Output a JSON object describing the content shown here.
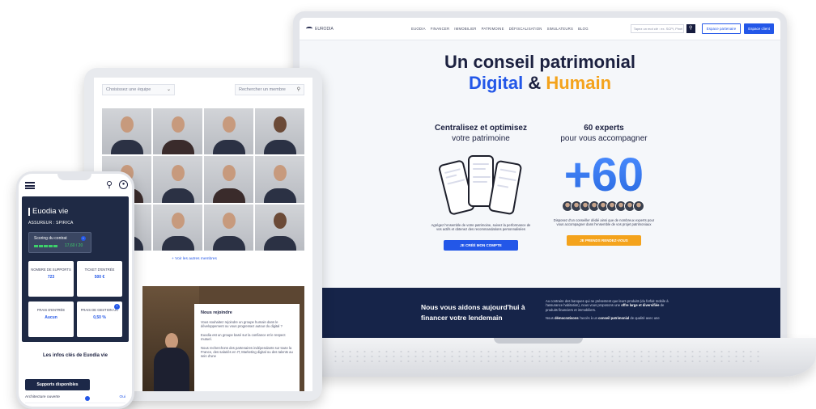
{
  "laptop": {
    "nav": {
      "logo": "EURODIA",
      "menu": [
        "EUODIA",
        "FINANCER",
        "IMMOBILIER",
        "PATRIMOINE",
        "DÉFISCALISATION",
        "SIMULATEURS",
        "BLOG"
      ],
      "search_placeholder": "Tapez un mot clé : ex. SCPI, Pinel",
      "search_icon": "search-icon",
      "btn_partner": "Espace partenaire",
      "btn_client": "Espace client"
    },
    "hero": {
      "line1": "Un conseil patrimonial",
      "word_digital": "Digital",
      "amp": "&",
      "word_humain": "Humain"
    },
    "left_col": {
      "title_l1": "Centralisez et optimisez",
      "title_l2": "votre patrimoine",
      "desc": "Agrégez l'ensemble de votre patrimoine, suivez la performance de vos actifs et obtenez des recommandations personnalisées",
      "cta": "JE CRÉÉ MON COMPTE"
    },
    "right_col": {
      "title_l1": "60 experts",
      "title_l2": "pour vous accompagner",
      "big_number": "+60",
      "desc": "Disposez d'un conseiller dédié ainsi que de nombreux experts pour vous accompagner dans l'ensemble de vos projet patrimoniaux",
      "cta": "JE PRENDS RENDEZ-VOUS"
    },
    "band": {
      "title": "Nous vous aidons aujourd'hui à financer votre lendemain",
      "p1_a": "Au contraire des banques qui ne présentent que leurs produits (du forfait mobile à l'assurance habitation), nous vous proposons une ",
      "p1_b": "offre large et diversifiée",
      "p1_c": " de produits financiers et immobiliers.",
      "p2_a": "Nous ",
      "p2_b": "démocratisons",
      "p2_c": " l'accès à un ",
      "p2_d": "conseil patrimonial",
      "p2_e": " de qualité avec une"
    },
    "colors": {
      "primary": "#2357e8",
      "accent": "#f4a31c",
      "navy": "#162449"
    }
  },
  "tablet": {
    "select_placeholder": "Choisissez une équipe",
    "search_placeholder": "Rechercher un membre",
    "more_link": "+ Voir les autres membres",
    "join": {
      "title": "Nous rejoindre",
      "p1": "Vous souhaitez rejoindre un groupe humain dans le développement ou vous progressez autour du digital ?",
      "p2": "Euodia est un groupe basé sur la confiance et le respect mutuel.",
      "p3": "Nous recherchons des partenaires indépendants sur toute la France, des salariés en IT, Marketing digital ou des talents au sein d'une"
    }
  },
  "phone": {
    "title": "Euodia vie",
    "insurer": "ASSUREUR : SPIRICA",
    "scoring_label": "Scoring du contrat",
    "score_value": "17,60 / 20",
    "cards": [
      {
        "label": "NOMBRE DE SUPPORTS",
        "value": "723"
      },
      {
        "label": "TICKET D'ENTRÉE",
        "value": "500 €"
      },
      {
        "label": "FRAIS D'ENTRÉE",
        "value": "Aucun"
      },
      {
        "label": "FRAIS DE GESTION UC",
        "value": "0,50 %"
      }
    ],
    "info_title": "Les infos clés de Euodia vie",
    "support_btn": "Supports disponibles",
    "rows": [
      {
        "label": "Architecture ouverte",
        "value": "Oui"
      }
    ]
  }
}
